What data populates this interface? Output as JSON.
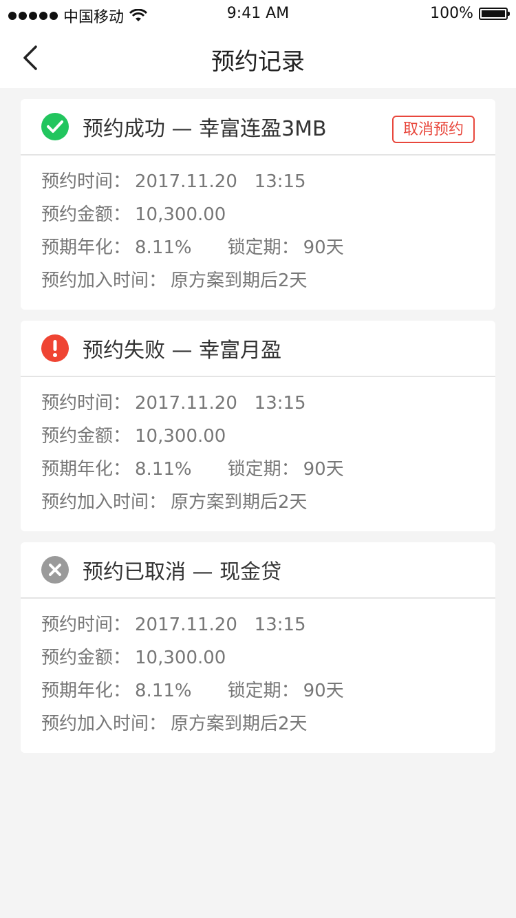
{
  "status_bar": {
    "carrier": "中国移动",
    "time": "9:41 AM",
    "battery": "100%"
  },
  "nav": {
    "title": "预约记录"
  },
  "records": [
    {
      "status": "success",
      "title": "预约成功 — 幸富连盈3MB",
      "cancel_label": "取消预约",
      "time_label": "预约时间：",
      "time_value": "2017.11.20   13:15",
      "amount_label": "预约金额：",
      "amount_value": "10,300.00",
      "yield_label": "预期年化：",
      "yield_value": "8.11%",
      "lock_label": "锁定期：",
      "lock_value": "90天",
      "join_label": "预约加入时间：",
      "join_value": "原方案到期后2天"
    },
    {
      "status": "failed",
      "title": "预约失败 — 幸富月盈",
      "time_label": "预约时间：",
      "time_value": "2017.11.20   13:15",
      "amount_label": "预约金额：",
      "amount_value": "10,300.00",
      "yield_label": "预期年化：",
      "yield_value": "8.11%",
      "lock_label": "锁定期：",
      "lock_value": "90天",
      "join_label": "预约加入时间：",
      "join_value": "原方案到期后2天"
    },
    {
      "status": "cancelled",
      "title": "预约已取消 — 现金贷",
      "time_label": "预约时间：",
      "time_value": "2017.11.20   13:15",
      "amount_label": "预约金额：",
      "amount_value": "10,300.00",
      "yield_label": "预期年化：",
      "yield_value": "8.11%",
      "lock_label": "锁定期：",
      "lock_value": "90天",
      "join_label": "预约加入时间：",
      "join_value": "原方案到期后2天"
    }
  ],
  "colors": {
    "success": "#22c55e",
    "failed": "#ef4433",
    "cancelled": "#9a9a9a",
    "accent": "#e8473c"
  },
  "icons": {
    "success": "check-circle-icon",
    "failed": "exclamation-circle-icon",
    "cancelled": "x-circle-icon",
    "back": "chevron-left-icon",
    "wifi": "wifi-icon",
    "battery": "battery-icon"
  }
}
